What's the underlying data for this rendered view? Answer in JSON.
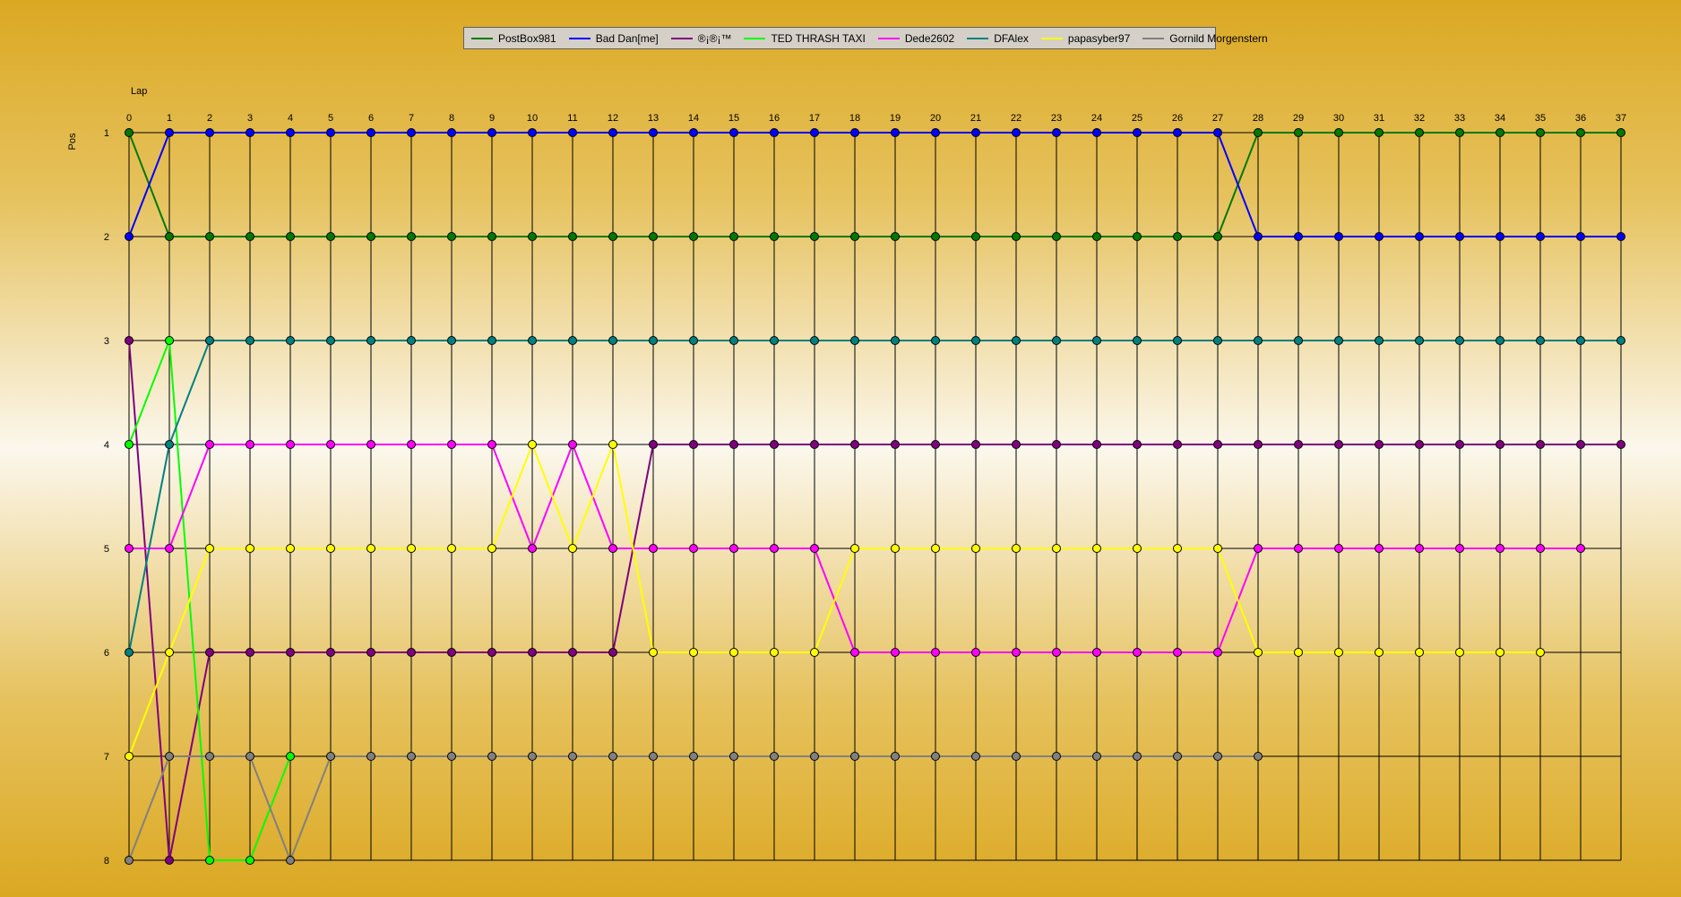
{
  "chart_data": {
    "type": "line",
    "title": "",
    "xlabel": "Lap",
    "ylabel": "Pos",
    "x": [
      0,
      1,
      2,
      3,
      4,
      5,
      6,
      7,
      8,
      9,
      10,
      11,
      12,
      13,
      14,
      15,
      16,
      17,
      18,
      19,
      20,
      21,
      22,
      23,
      24,
      25,
      26,
      27,
      28,
      29,
      30,
      31,
      32,
      33,
      34,
      35,
      36,
      37
    ],
    "yticks": [
      1,
      2,
      3,
      4,
      5,
      6,
      7,
      8
    ],
    "xlim": [
      0,
      37
    ],
    "ylim": [
      1,
      8
    ],
    "y_inverted": true,
    "grid": true,
    "legend_position": "top-center",
    "series": [
      {
        "name": "PostBox981",
        "color": "#007a00",
        "values": [
          1,
          2,
          2,
          2,
          2,
          2,
          2,
          2,
          2,
          2,
          2,
          2,
          2,
          2,
          2,
          2,
          2,
          2,
          2,
          2,
          2,
          2,
          2,
          2,
          2,
          2,
          2,
          2,
          1,
          1,
          1,
          1,
          1,
          1,
          1,
          1,
          1,
          1
        ]
      },
      {
        "name": "Bad Dan[me]",
        "color": "#0000ff",
        "values": [
          2,
          1,
          1,
          1,
          1,
          1,
          1,
          1,
          1,
          1,
          1,
          1,
          1,
          1,
          1,
          1,
          1,
          1,
          1,
          1,
          1,
          1,
          1,
          1,
          1,
          1,
          1,
          1,
          2,
          2,
          2,
          2,
          2,
          2,
          2,
          2,
          2,
          2
        ]
      },
      {
        "name": "®¡®¡™",
        "color": "#800080",
        "values": [
          3,
          8,
          6,
          6,
          6,
          6,
          6,
          6,
          6,
          6,
          6,
          6,
          6,
          4,
          4,
          4,
          4,
          4,
          4,
          4,
          4,
          4,
          4,
          4,
          4,
          4,
          4,
          4,
          4,
          4,
          4,
          4,
          4,
          4,
          4,
          4,
          4,
          4
        ]
      },
      {
        "name": "TED THRASH TAXI",
        "color": "#00ff00",
        "values": [
          4,
          3,
          8,
          8,
          7
        ]
      },
      {
        "name": "Dede2602",
        "color": "#ff00ff",
        "values": [
          5,
          5,
          4,
          4,
          4,
          4,
          4,
          4,
          4,
          4,
          5,
          4,
          5,
          5,
          5,
          5,
          5,
          5,
          6,
          6,
          6,
          6,
          6,
          6,
          6,
          6,
          6,
          6,
          5,
          5,
          5,
          5,
          5,
          5,
          5,
          5,
          5
        ]
      },
      {
        "name": "DFAlex",
        "color": "#008080",
        "values": [
          6,
          4,
          3,
          3,
          3,
          3,
          3,
          3,
          3,
          3,
          3,
          3,
          3,
          3,
          3,
          3,
          3,
          3,
          3,
          3,
          3,
          3,
          3,
          3,
          3,
          3,
          3,
          3,
          3,
          3,
          3,
          3,
          3,
          3,
          3,
          3,
          3,
          3
        ]
      },
      {
        "name": "papasyber97",
        "color": "#ffff00",
        "values": [
          7,
          6,
          5,
          5,
          5,
          5,
          5,
          5,
          5,
          5,
          4,
          5,
          4,
          6,
          6,
          6,
          6,
          6,
          5,
          5,
          5,
          5,
          5,
          5,
          5,
          5,
          5,
          5,
          6,
          6,
          6,
          6,
          6,
          6,
          6,
          6
        ]
      },
      {
        "name": "Gornild Morgenstern",
        "color": "#808080",
        "values": [
          8,
          7,
          7,
          7,
          8,
          7,
          7,
          7,
          7,
          7,
          7,
          7,
          7,
          7,
          7,
          7,
          7,
          7,
          7,
          7,
          7,
          7,
          7,
          7,
          7,
          7,
          7,
          7,
          7
        ]
      }
    ]
  }
}
